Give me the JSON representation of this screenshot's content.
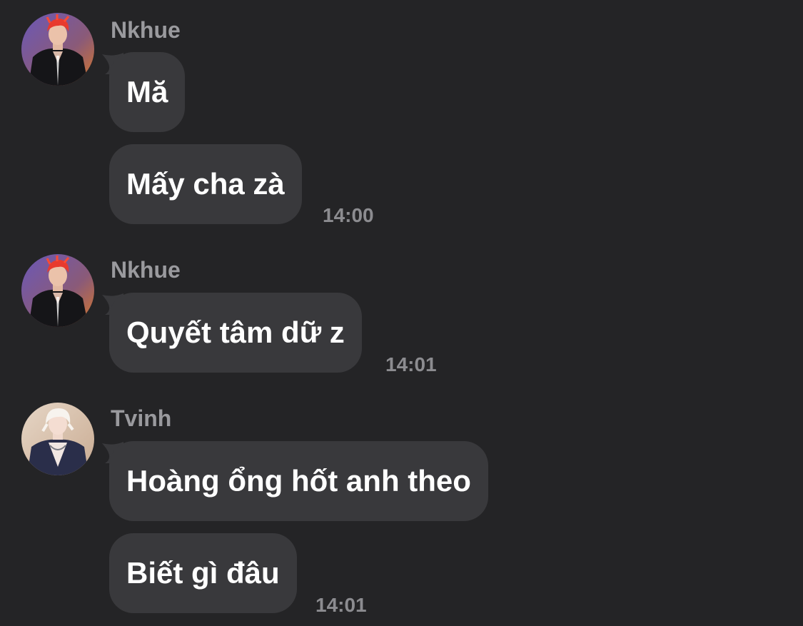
{
  "groups": [
    {
      "sender": "Nkhue",
      "avatar_icon": "user-avatar-red-hair",
      "messages": [
        "Mă",
        "Mấy cha zà"
      ],
      "time": "14:00"
    },
    {
      "sender": "Nkhue",
      "avatar_icon": "user-avatar-red-hair",
      "messages": [
        "Quyết tâm dữ z"
      ],
      "time": "14:01"
    },
    {
      "sender": "Tvinh",
      "avatar_icon": "user-avatar-blonde-hair",
      "messages": [
        "Hoàng ổng hốt anh theo",
        "Biết gì đâu"
      ],
      "time": "14:01"
    }
  ],
  "colors": {
    "background": "#242426",
    "bubble": "#39393c",
    "text": "#ffffff",
    "sender": "#9a9a9e",
    "timestamp": "#8c8c90"
  }
}
